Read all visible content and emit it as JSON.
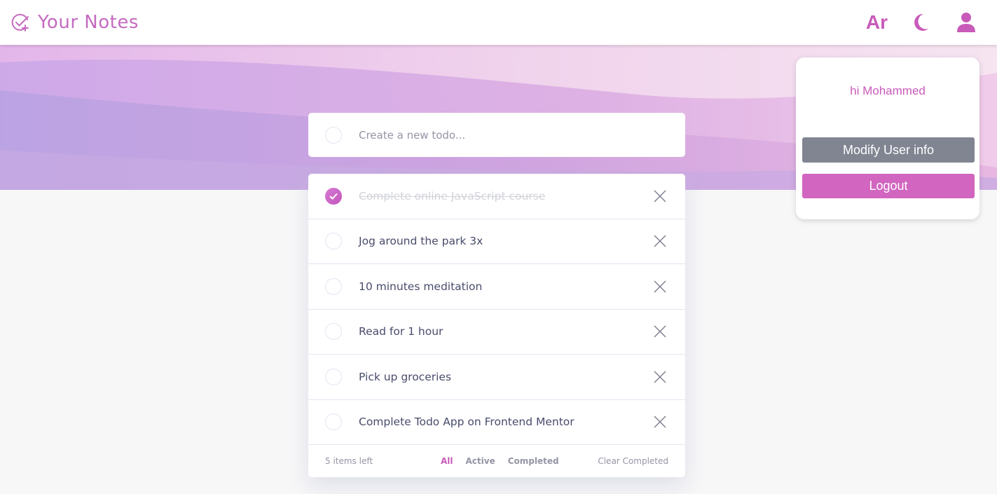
{
  "header": {
    "brand_title": "Your Notes",
    "brand_icon": "check-circle-plus-icon",
    "language_label": "Ar",
    "theme_icon": "moon-icon",
    "user_icon": "user-icon"
  },
  "new_todo": {
    "placeholder": "Create a new todo..."
  },
  "todos": [
    {
      "text": "Complete online JavaScript course",
      "completed": true
    },
    {
      "text": "Jog around the park 3x",
      "completed": false
    },
    {
      "text": "10 minutes meditation",
      "completed": false
    },
    {
      "text": "Read for 1 hour",
      "completed": false
    },
    {
      "text": "Pick up groceries",
      "completed": false
    },
    {
      "text": "Complete Todo App on Frontend Mentor",
      "completed": false
    }
  ],
  "footer": {
    "items_left": "5 items left",
    "filters": [
      "All",
      "Active",
      "Completed"
    ],
    "active_filter": "All",
    "clear_label": "Clear Completed"
  },
  "user_panel": {
    "greeting": "hi Mohammed",
    "modify_label": "Modify User info",
    "logout_label": "Logout"
  },
  "colors": {
    "accent": "#c85ab9",
    "modify_button": "#818592",
    "logout_button": "#d165bf"
  }
}
